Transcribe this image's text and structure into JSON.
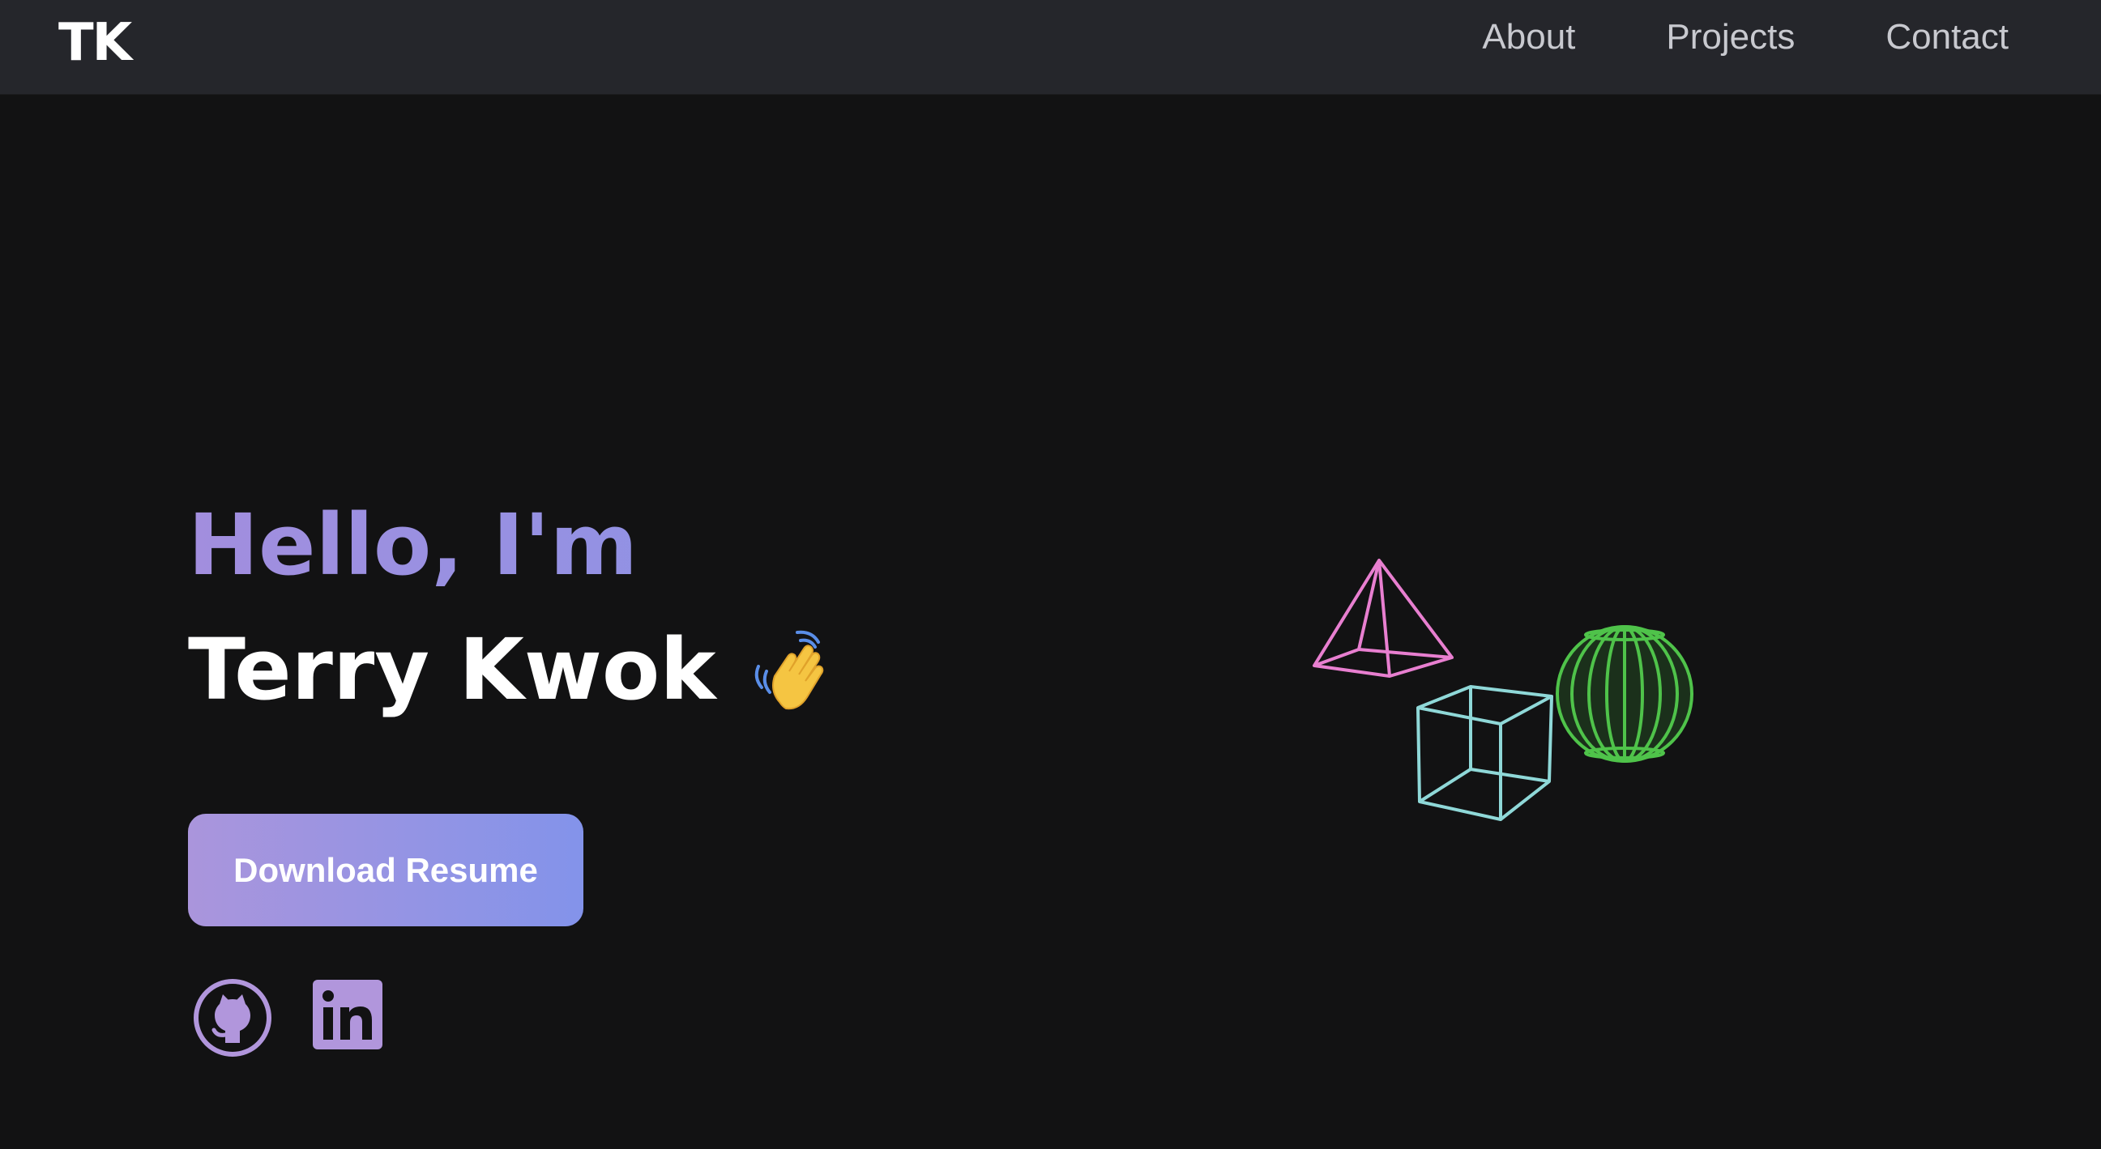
{
  "header": {
    "logo": "TK",
    "nav": [
      {
        "label": "About"
      },
      {
        "label": "Projects"
      },
      {
        "label": "Contact"
      }
    ]
  },
  "hero": {
    "greeting": "Hello, I'm",
    "name": "Terry Kwok",
    "wave_emoji": "waving-hand-icon",
    "resume_button": "Download Resume",
    "social": [
      {
        "icon": "github-icon"
      },
      {
        "icon": "linkedin-icon"
      }
    ]
  },
  "scene": {
    "shapes": [
      {
        "name": "pyramid",
        "color": "#e87fd0"
      },
      {
        "name": "cube",
        "color": "#8fd8d8"
      },
      {
        "name": "sphere",
        "color": "#4fc34a"
      }
    ]
  },
  "colors": {
    "background": "#121213",
    "navbar": "#25262b",
    "accent_start": "#a28ede",
    "accent_end": "#8393ea"
  }
}
